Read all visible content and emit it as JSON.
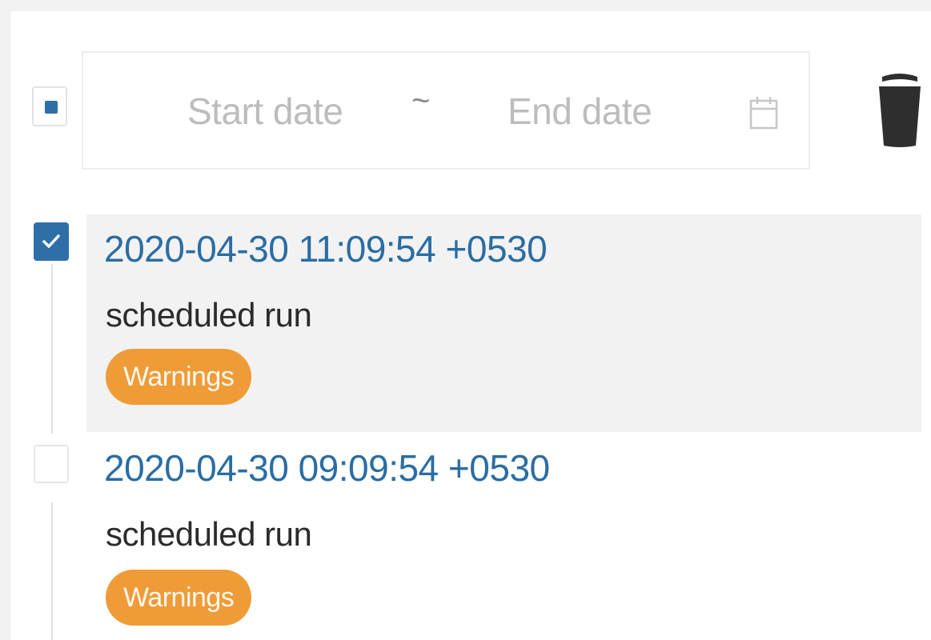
{
  "filter": {
    "start_placeholder": "Start date",
    "separator": "~",
    "end_placeholder": "End date"
  },
  "colors": {
    "accent": "#2f6fa8",
    "timestamp": "#2a6da3",
    "warning_badge": "#ef9b38"
  },
  "icons": {
    "calendar": "calendar-icon",
    "delete": "trash-icon",
    "check": "checkmark-icon"
  },
  "runs": [
    {
      "timestamp": "2020-04-30 11:09:54 +0530",
      "description": "scheduled run",
      "status": "Warnings",
      "checked": true
    },
    {
      "timestamp": "2020-04-30 09:09:54 +0530",
      "description": "scheduled run",
      "status": "Warnings",
      "checked": false
    }
  ]
}
